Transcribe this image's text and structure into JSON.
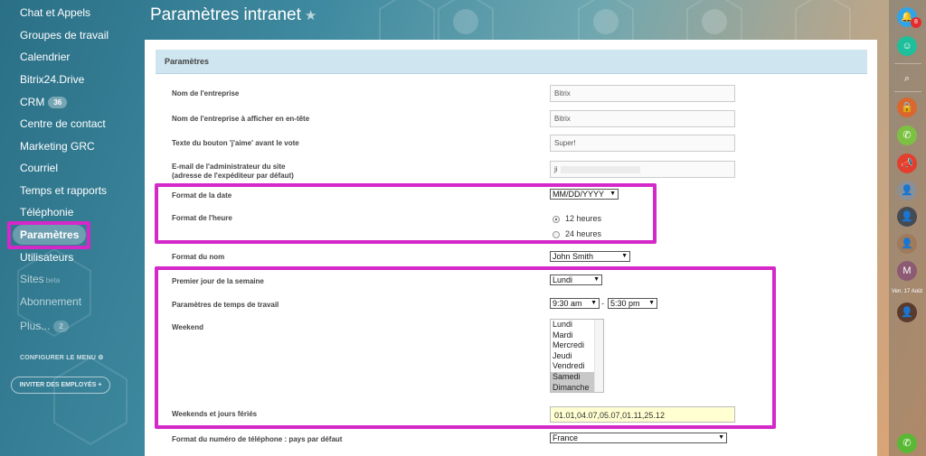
{
  "left_menu": {
    "items": [
      {
        "label": "Chat et Appels"
      },
      {
        "label": "Groupes de travail"
      },
      {
        "label": "Calendrier"
      },
      {
        "label": "Bitrix24.Drive"
      },
      {
        "label": "CRM",
        "badge": "36"
      },
      {
        "label": "Centre de contact"
      },
      {
        "label": "Marketing GRC"
      },
      {
        "label": "Courriel"
      },
      {
        "label": "Temps et rapports"
      },
      {
        "label": "Téléphonie"
      },
      {
        "label": "Paramètres"
      },
      {
        "label": "Utilisateurs"
      },
      {
        "label": "Sites",
        "suffix": "beta"
      },
      {
        "label": "Abonnement"
      },
      {
        "label": "Plus...",
        "badge": "2"
      }
    ],
    "configure": "CONFIGURER LE MENU",
    "invite": "INVITER DES EMPLOYÉS"
  },
  "page": {
    "title": "Paramètres intranet",
    "section": "Paramètres"
  },
  "form": {
    "company_name": {
      "label": "Nom de l'entreprise",
      "value": "Bitrix"
    },
    "company_header": {
      "label": "Nom de l'entreprise à afficher en en-tête",
      "value": "Bitrix"
    },
    "like_button": {
      "label": "Texte du bouton 'j'aime' avant le vote",
      "value": "Super!"
    },
    "admin_email": {
      "label1": "E-mail de l'administrateur du site",
      "label2": "(adresse de l'expéditeur par défaut)",
      "value": "ji"
    },
    "date_format": {
      "label": "Format de la date",
      "value": "MM/DD/YYYY"
    },
    "time_format": {
      "label": "Format de l'heure",
      "options": [
        "12 heures",
        "24 heures"
      ],
      "selected": "12 heures"
    },
    "name_format": {
      "label": "Format du nom",
      "value": "John Smith"
    },
    "first_day": {
      "label": "Premier jour de la semaine",
      "value": "Lundi"
    },
    "work_time": {
      "label": "Paramètres de temps de travail",
      "start": "9:30 am",
      "separator": "-",
      "end": "5:30 pm"
    },
    "weekend": {
      "label": "Weekend",
      "options": [
        "Lundi",
        "Mardi",
        "Mercredi",
        "Jeudi",
        "Vendredi",
        "Samedi",
        "Dimanche"
      ],
      "selected": [
        "Samedi",
        "Dimanche"
      ]
    },
    "holidays": {
      "label": "Weekends et jours fériés",
      "value": "01.01,04.07,05.07,01.11,25.12"
    },
    "phone_country": {
      "label": "Format du numéro de téléphone : pays par défaut",
      "value": "France"
    }
  },
  "right_bar": {
    "notification_count": "8",
    "date_label": "Ven. 17 Août",
    "avatar_letter": "M"
  },
  "colors": {
    "highlight": "#d428c8",
    "section_header": "#cfe6f0",
    "holiday_field": "#ffffd2"
  },
  "icons": [
    "bell-icon",
    "chat-icon",
    "search-icon",
    "lock-icon",
    "phone-icon",
    "megaphone-icon",
    "star-icon",
    "call-icon"
  ]
}
